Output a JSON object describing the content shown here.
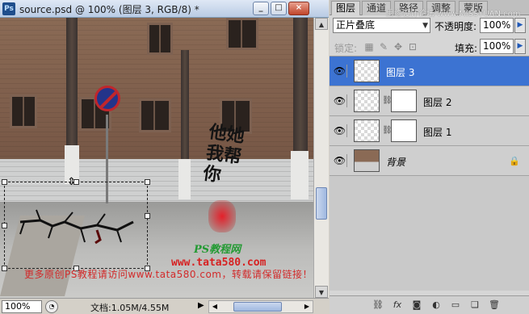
{
  "document": {
    "title": "source.psd @ 100% (图层 3, RGB/8) *",
    "app_icon": "Ps",
    "window_buttons": {
      "minimize": "_",
      "maximize": "□",
      "close": "×"
    },
    "zoom": "100%",
    "doc_size": "文档:1.05M/4.55M",
    "canvas_text": {
      "calligraphy": "他她我帮你",
      "watermark_title": "PS教程网",
      "watermark_url": "www.tata580.com",
      "watermark_note": "更多原创PS教程请访问www.tata580.com，转载请保留链接！"
    }
  },
  "panel": {
    "tabs": [
      "图层",
      "通道",
      "路径",
      "调整",
      "蒙版"
    ],
    "top_watermark": "思缘设计论坛 www.MISSYUAN.com",
    "blend_mode": "正片叠底",
    "opacity_label": "不透明度:",
    "opacity_value": "100%",
    "lock_label": "锁定:",
    "fill_label": "填充:",
    "fill_value": "100%",
    "layers": [
      {
        "name": "图层 3",
        "selected": true,
        "has_mask": false
      },
      {
        "name": "图层 2",
        "selected": false,
        "has_mask": true
      },
      {
        "name": "图层 1",
        "selected": false,
        "has_mask": true
      },
      {
        "name": "背景",
        "selected": false,
        "has_mask": false,
        "locked": true
      }
    ],
    "footer_icons": [
      "link-icon",
      "fx-icon",
      "mask-icon",
      "adjustment-icon",
      "group-icon",
      "new-layer-icon",
      "trash-icon"
    ]
  },
  "colors": {
    "selection_blue": "#3c73d2",
    "watermark_green": "#239a33",
    "watermark_red": "#d62222"
  }
}
